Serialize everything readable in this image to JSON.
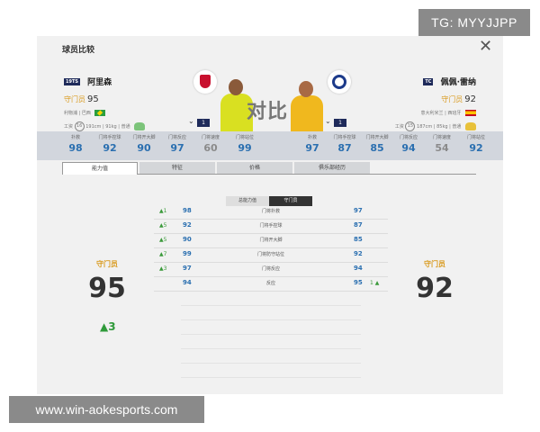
{
  "watermark_top": "TG: MYYJJPP",
  "watermark_bottom": "www.win-aokesports.com",
  "dialog": {
    "title": "球员比较",
    "close_symbol": "✕",
    "versus_label": "对比"
  },
  "player1": {
    "badge": "19TS",
    "name": "阿里森",
    "position": "守门员",
    "rating": "95",
    "info_line": "利物浦 | 巴西",
    "work_label": "工资",
    "wage": "16",
    "height": "191cm",
    "weight": "91kg",
    "foot": "普通",
    "level": "1"
  },
  "player2": {
    "badge": "TC",
    "name": "佩佩·雷纳",
    "position": "守门员",
    "rating": "92",
    "info_line": "意大利米兰 | 西班牙",
    "work_label": "工资",
    "wage": "15",
    "height": "187cm",
    "weight": "85kg",
    "foot": "普通",
    "level": "1"
  },
  "stats_left": [
    {
      "label": "扑救",
      "value": "98",
      "grey": false
    },
    {
      "label": "门将手控球",
      "value": "92",
      "grey": false
    },
    {
      "label": "门将开大脚",
      "value": "90",
      "grey": false
    },
    {
      "label": "门将反应",
      "value": "97",
      "grey": false
    },
    {
      "label": "门将速度",
      "value": "60",
      "grey": true
    },
    {
      "label": "门将站位",
      "value": "99",
      "grey": false
    }
  ],
  "stats_right": [
    {
      "label": "扑救",
      "value": "97",
      "grey": false
    },
    {
      "label": "门将手控球",
      "value": "87",
      "grey": false
    },
    {
      "label": "门将开大脚",
      "value": "85",
      "grey": false
    },
    {
      "label": "门将反应",
      "value": "94",
      "grey": false
    },
    {
      "label": "门将速度",
      "value": "54",
      "grey": true
    },
    {
      "label": "门将站位",
      "value": "92",
      "grey": false
    }
  ],
  "tabs": [
    "能力值",
    "特征",
    "价格",
    "俱乐部经历"
  ],
  "subtabs": [
    "总能力值",
    "守门员"
  ],
  "comparison_rows": [
    {
      "left_diff": "▲1",
      "left": "98",
      "name": "门将扑救",
      "right": "97",
      "right_diff": ""
    },
    {
      "left_diff": "▲5",
      "left": "92",
      "name": "门将手控球",
      "right": "87",
      "right_diff": ""
    },
    {
      "left_diff": "▲5",
      "left": "90",
      "name": "门将开大脚",
      "right": "85",
      "right_diff": ""
    },
    {
      "left_diff": "▲7",
      "left": "99",
      "name": "门将防守站位",
      "right": "92",
      "right_diff": ""
    },
    {
      "left_diff": "▲3",
      "left": "97",
      "name": "门将反应",
      "right": "94",
      "right_diff": ""
    },
    {
      "left_diff": "",
      "left": "94",
      "name": "反应",
      "right": "95",
      "right_diff": "1 ▲"
    }
  ],
  "overall_left": {
    "position": "守门员",
    "value": "95",
    "gain": "▲3"
  },
  "overall_right": {
    "position": "守门员",
    "value": "92"
  },
  "colors": {
    "accent_blue": "#2a6fb0",
    "position_orange": "#d99a1e",
    "up_green": "#3a9a3a"
  }
}
